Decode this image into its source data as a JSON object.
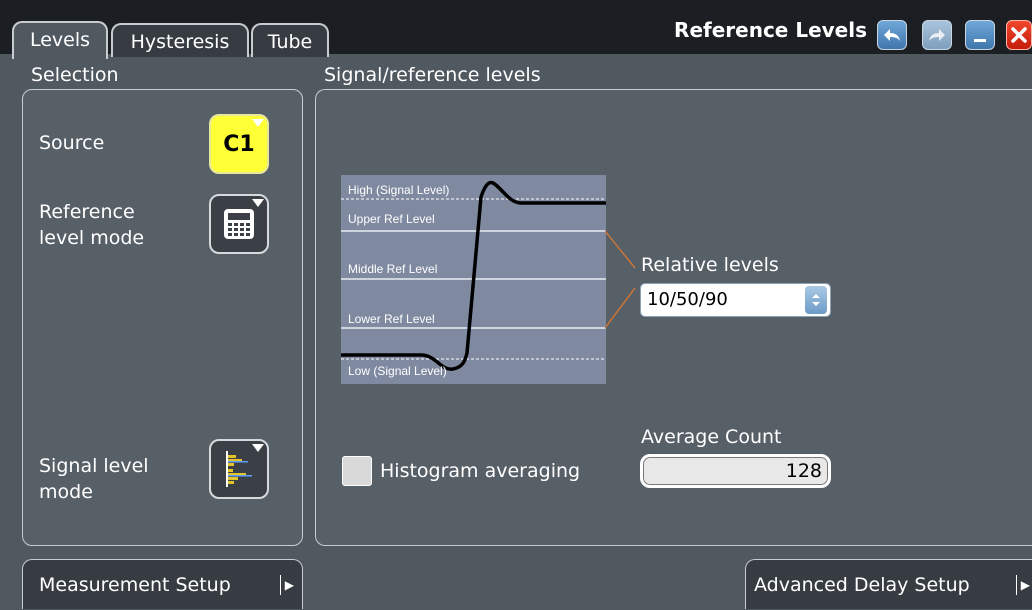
{
  "tabs": [
    {
      "label": "Levels",
      "active": true
    },
    {
      "label": "Hysteresis",
      "active": false
    },
    {
      "label": "Tube",
      "active": false
    }
  ],
  "window": {
    "title": "Reference Levels",
    "buttons": [
      "undo-icon",
      "redo-icon",
      "minimize-icon",
      "close-icon"
    ]
  },
  "selection": {
    "heading": "Selection",
    "source_label": "Source",
    "source_value": "C1",
    "ref_mode_label_1": "Reference",
    "ref_mode_label_2": "level mode",
    "ref_mode_icon": "calculator-icon",
    "signal_mode_label_1": "Signal level",
    "signal_mode_label_2": "mode",
    "signal_mode_icon": "histogram-icon"
  },
  "signal": {
    "heading": "Signal/reference levels",
    "diagram": {
      "high": "High (Signal Level)",
      "upper": "Upper Ref Level",
      "middle": "Middle Ref Level",
      "lower": "Lower Ref Level",
      "low": "Low (Signal Level)"
    },
    "relative_label": "Relative levels",
    "relative_value": "10/50/90",
    "histogram_label": "Histogram averaging",
    "histogram_checked": false,
    "avg_count_label": "Average Count",
    "avg_count_value": "128"
  },
  "bottom": {
    "measurement_setup": "Measurement Setup",
    "advanced_delay_setup": "Advanced Delay Setup"
  },
  "colors": {
    "background": "#505860",
    "source_yellow": "#ffff35",
    "close_red": "#e0301c",
    "accent_blue": "#4f8ac3",
    "connector_orange": "#c8753a"
  }
}
